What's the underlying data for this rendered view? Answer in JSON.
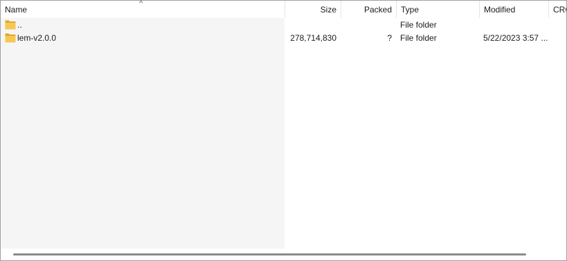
{
  "header": {
    "columns": [
      {
        "label": "Name"
      },
      {
        "label": "Size"
      },
      {
        "label": "Packed"
      },
      {
        "label": "Type"
      },
      {
        "label": "Modified"
      },
      {
        "label": "CRC"
      }
    ],
    "sort_indicator": "^"
  },
  "rows": [
    {
      "icon": "folder-icon",
      "name": "..",
      "size": "",
      "packed": "",
      "type": "File folder",
      "modified": ""
    },
    {
      "icon": "folder-icon",
      "name": "lem-v2.0.0",
      "size": "278,714,830",
      "packed": "?",
      "type": "File folder",
      "modified": "5/22/2023 3:57 ..."
    }
  ],
  "colors": {
    "folder": "#f2c14e",
    "folder_dark": "#e0a82e",
    "name_column_bg": "#f5f5f5",
    "scrollbar_thumb": "#8a8a8a"
  }
}
